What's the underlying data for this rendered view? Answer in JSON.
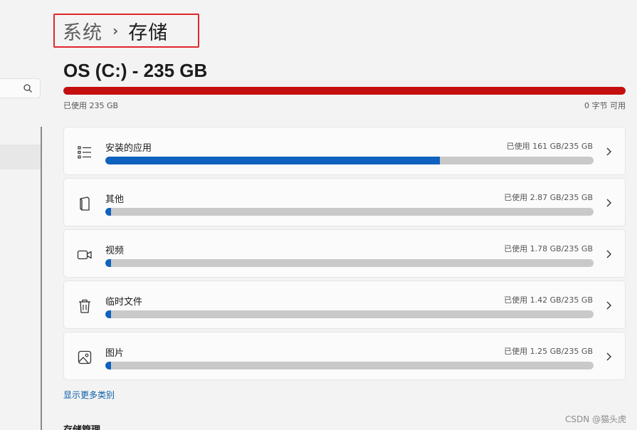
{
  "breadcrumb": {
    "parent": "系统",
    "separator": "›",
    "current": "存储"
  },
  "drive": {
    "title": "OS (C:) - 235 GB",
    "used_label": "已使用 235 GB",
    "free_label": "0 字节 可用",
    "used_fraction": 1.0,
    "bar_color": "#c50f0f"
  },
  "categories": [
    {
      "label": "安装的应用",
      "usage": "已使用 161 GB/235 GB",
      "fraction": 0.685,
      "icon": "list-icon"
    },
    {
      "label": "其他",
      "usage": "已使用 2.87 GB/235 GB",
      "fraction": 0.0122,
      "icon": "document-icon"
    },
    {
      "label": "视频",
      "usage": "已使用 1.78 GB/235 GB",
      "fraction": 0.0076,
      "icon": "video-icon"
    },
    {
      "label": "临时文件",
      "usage": "已使用 1.42 GB/235 GB",
      "fraction": 0.006,
      "icon": "trash-icon"
    },
    {
      "label": "图片",
      "usage": "已使用 1.25 GB/235 GB",
      "fraction": 0.0053,
      "icon": "image-icon"
    }
  ],
  "more_link": "显示更多类别",
  "section_heading": "存储管理",
  "watermark": "CSDN @猫头虎",
  "colors": {
    "accent": "#0f62be",
    "critical": "#c50f0f",
    "highlight_border": "#e0262a",
    "link": "#0a5ea8"
  }
}
